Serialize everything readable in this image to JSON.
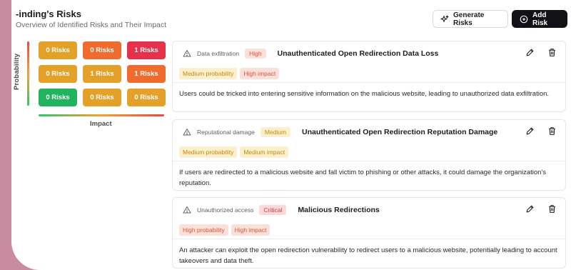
{
  "header": {
    "title": "-inding's Risks",
    "subtitle": "Overview of Identified Risks and Their Impact",
    "generate_label": "Generate Risks",
    "add_label": "Add Risk"
  },
  "matrix": {
    "probability_label": "Probability",
    "impact_label": "Impact",
    "rows": [
      [
        {
          "label": "0 Risks",
          "color": "#e4a12a"
        },
        {
          "label": "0 Risks",
          "color": "#f06b2e"
        },
        {
          "label": "1 Risks",
          "color": "#e7304a"
        }
      ],
      [
        {
          "label": "0 Risks",
          "color": "#e4a12a"
        },
        {
          "label": "1 Risks",
          "color": "#e4a12a"
        },
        {
          "label": "1 Risks",
          "color": "#f06b2e"
        }
      ],
      [
        {
          "label": "0 Risks",
          "color": "#22b35f"
        },
        {
          "label": "0 Risks",
          "color": "#e4a12a"
        },
        {
          "label": "0 Risks",
          "color": "#e4a12a"
        }
      ]
    ]
  },
  "risks": [
    {
      "category": "Data exfiltration",
      "severity": "High",
      "title": "Unauthenticated Open Redirection Data Loss",
      "probability_tag": "Medium probability",
      "impact_tag": "High impact",
      "description": "Users could be tricked into entering sensitive information on the malicious website, leading to unauthorized data exfiltration."
    },
    {
      "category": "Reputational damage",
      "severity": "Medium",
      "title": "Unauthenticated Open Redirection Reputation Damage",
      "probability_tag": "Medium probability",
      "impact_tag": "Medium impact",
      "description": "If users are redirected to a malicious website and fall victim to phishing or other attacks, it could damage the organization's reputation."
    },
    {
      "category": "Unauthorized access",
      "severity": "Critical",
      "title": "Malicious Redirections",
      "probability_tag": "High probability",
      "impact_tag": "High impact",
      "description": "An attacker can exploit the open redirection vulnerability to redirect users to a malicious website, potentially leading to account takeovers and data theft."
    }
  ]
}
